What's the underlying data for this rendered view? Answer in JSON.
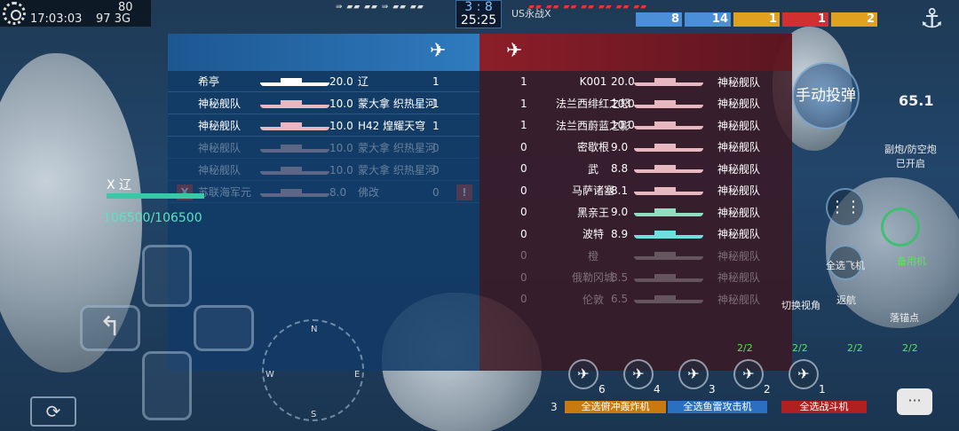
{
  "status_bar": {
    "time": "17:03:03",
    "battery": "80",
    "signal": "97",
    "network": "3G"
  },
  "match": {
    "score_left": "3",
    "score_sep": ":",
    "score_right": "8",
    "timer": "25:25",
    "enemy_player": "US永战X",
    "left_flags": "⇛ ▰▰ ▰▰ ⇛ ▰▰ ▰▰",
    "right_flags": "▰▰ ▰▰ ▰▰ ▰▰ ▰▰ ▰▰ ▰▰"
  },
  "counters": [
    {
      "value": "8",
      "color": "#4a8fd8"
    },
    {
      "value": "14",
      "color": "#4a8fd8"
    },
    {
      "value": "1",
      "color": "#e0a020"
    },
    {
      "value": "1",
      "color": "#d03030"
    },
    {
      "value": "2",
      "color": "#e0a020"
    }
  ],
  "left_team": [
    {
      "player": "希亭",
      "rating": "20.0",
      "ship": "辽",
      "kills": "1",
      "ship_color": "#ffffff",
      "dim": false,
      "x": false
    },
    {
      "player": "神秘舰队",
      "rating": "10.0",
      "ship": "蒙大拿 织热星河",
      "kills": "1",
      "ship_color": "#e8b8c0",
      "dim": false,
      "x": false
    },
    {
      "player": "神秘舰队",
      "rating": "10.0",
      "ship": "H42 煌耀天穹",
      "kills": "1",
      "ship_color": "#e8b8c0",
      "dim": false,
      "x": false
    },
    {
      "player": "神秘舰队",
      "rating": "10.0",
      "ship": "蒙大拿 织热星河",
      "kills": "0",
      "ship_color": "#e8b8c0",
      "dim": true,
      "x": false
    },
    {
      "player": "神秘舰队",
      "rating": "10.0",
      "ship": "蒙大拿 织热星河",
      "kills": "0",
      "ship_color": "#e8b8c0",
      "dim": true,
      "x": false
    },
    {
      "player": "苏联海军元",
      "rating": "8.0",
      "ship": "佛改",
      "kills": "0",
      "ship_color": "#e8b8c0",
      "dim": true,
      "x": true
    }
  ],
  "right_team": [
    {
      "kills": "1",
      "ship": "K001",
      "rating": "20.0",
      "player": "神秘舰队",
      "ship_color": "#e8b8c0",
      "dim": false
    },
    {
      "kills": "1",
      "ship": "法兰西绯红之怒",
      "rating": "10.0",
      "player": "神秘舰队",
      "ship_color": "#e8b8c0",
      "dim": false
    },
    {
      "kills": "1",
      "ship": "法兰西蔚蓝之影",
      "rating": "10.0",
      "player": "神秘舰队",
      "ship_color": "#e8b8c0",
      "dim": false
    },
    {
      "kills": "0",
      "ship": "密歇根",
      "rating": "9.0",
      "player": "神秘舰队",
      "ship_color": "#e8b8c0",
      "dim": false
    },
    {
      "kills": "0",
      "ship": "武",
      "rating": "8.8",
      "player": "神秘舰队",
      "ship_color": "#e8b8c0",
      "dim": false
    },
    {
      "kills": "0",
      "ship": "马萨诸塞",
      "rating": "8.1",
      "player": "神秘舰队",
      "ship_color": "#e8b8c0",
      "dim": false
    },
    {
      "kills": "0",
      "ship": "黑亲王",
      "rating": "9.0",
      "player": "神秘舰队",
      "ship_color": "#8fe0c0",
      "dim": false
    },
    {
      "kills": "0",
      "ship": "波特",
      "rating": "8.9",
      "player": "神秘舰队",
      "ship_color": "#6fe0e0",
      "dim": false
    },
    {
      "kills": "0",
      "ship": "橙",
      "rating": "",
      "player": "神秘舰队",
      "ship_color": "#bbbbbb",
      "dim": true
    },
    {
      "kills": "0",
      "ship": "俄勒冈城",
      "rating": "8.5",
      "player": "神秘舰队",
      "ship_color": "#bbbbbb",
      "dim": true
    },
    {
      "kills": "0",
      "ship": "伦敦",
      "rating": "6.5",
      "player": "神秘舰队",
      "ship_color": "#bbbbbb",
      "dim": true
    }
  ],
  "player_ship": {
    "name": "X 辽",
    "hp": "106500/106500"
  },
  "hud": {
    "manual_drop": "手动投弹",
    "speed": "65.1",
    "aa_status": "副炮/防空炮\n已开启",
    "backup_plane": "备用机",
    "select_all_planes": "全选飞机",
    "return": "返航",
    "switch_view": "切换视角",
    "anchor_label": "落锚点",
    "compass_n": "N",
    "compass_s": "S",
    "compass_w": "W",
    "compass_e": "E"
  },
  "squadrons": [
    {
      "fraction": "",
      "count": "6",
      "label": "全选俯冲轰炸机",
      "color": "#c87a10"
    },
    {
      "fraction": "2/2",
      "count": "4",
      "label": "全选鱼雷攻击机",
      "color": "#2a6fc0"
    },
    {
      "fraction": "2/2",
      "count": "3",
      "label": "",
      "color": "#2a6fc0"
    },
    {
      "fraction": "2/2",
      "count": "2",
      "label": "全选战斗机",
      "color": "#b02020"
    },
    {
      "fraction": "2/2",
      "count": "1",
      "label": "",
      "color": "#b02020"
    }
  ],
  "bottom_left_count": "3"
}
